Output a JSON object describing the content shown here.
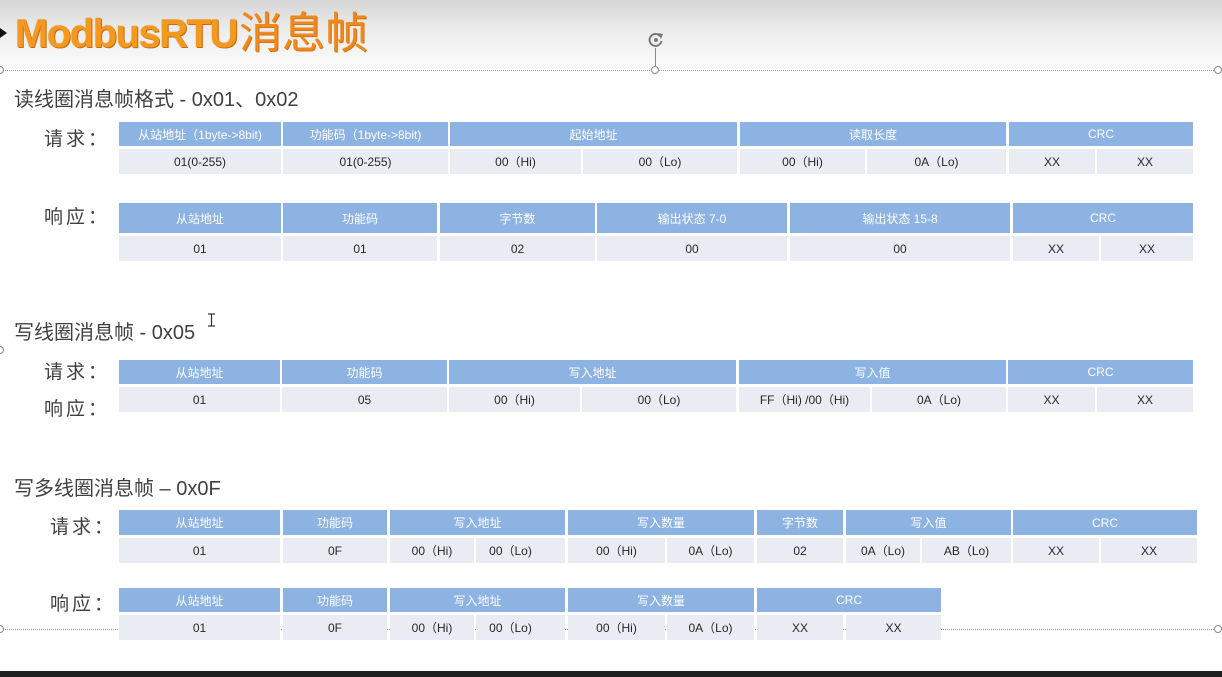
{
  "slide": {
    "title_main": "ModbusRTU",
    "title_cn": "消息帧"
  },
  "read_coils": {
    "heading": "读线圈消息帧格式 - 0x01、0x02",
    "request_label": "请求：",
    "response_label": "响应：",
    "request": {
      "headers": [
        "从站地址（1byte->8bit)",
        "功能码（1byte->8bit)",
        "起始地址",
        "读取长度",
        "CRC"
      ],
      "values": [
        "01(0-255)",
        "01(0-255)",
        "00（Hi)",
        "00（Lo)",
        "00（Hi)",
        "0A（Lo)",
        "XX",
        "XX"
      ]
    },
    "response": {
      "headers": [
        "从站地址",
        "功能码",
        "字节数",
        "输出状态 7-0",
        "输出状态 15-8",
        "CRC"
      ],
      "values": [
        "01",
        "01",
        "02",
        "00",
        "00",
        "XX",
        "XX"
      ]
    }
  },
  "write_coil": {
    "heading": "写线圈消息帧 - 0x05",
    "request_label": "请求：",
    "response_label": "响应：",
    "frame": {
      "headers": [
        "从站地址",
        "功能码",
        "写入地址",
        "写入值",
        "CRC"
      ],
      "values": [
        "01",
        "05",
        "00（Hi)",
        "00（Lo)",
        "FF（Hi) /00（Hi)",
        "0A（Lo)",
        "XX",
        "XX"
      ]
    }
  },
  "write_multiple_coils": {
    "heading": "写多线圈消息帧 – 0x0F",
    "request_label": "请求：",
    "response_label": "响应：",
    "request": {
      "headers": [
        "从站地址",
        "功能码",
        "写入地址",
        "写入数量",
        "字节数",
        "写入值",
        "CRC"
      ],
      "values": [
        "01",
        "0F",
        "00（Hi)",
        "00（Lo)",
        "00（Hi)",
        "0A（Lo)",
        "02",
        "0A（Lo)",
        "AB（Lo)",
        "XX",
        "XX"
      ]
    },
    "response": {
      "headers": [
        "从站地址",
        "功能码",
        "写入地址",
        "写入数量",
        "CRC"
      ],
      "values": [
        "01",
        "0F",
        "00（Hi)",
        "00（Lo)",
        "00（Hi)",
        "0A（Lo)",
        "XX",
        "XX"
      ]
    }
  },
  "icons": {
    "rotate_handle": "rotate-handle-icon",
    "text_cursor": "text-cursor-icon",
    "pointer": "pointer-arrow-icon"
  },
  "colors": {
    "title_orange": "#f39a1e",
    "header_blue": "#8db3e2",
    "cell_gray": "#e9edf3",
    "heading_text": "#404040"
  }
}
